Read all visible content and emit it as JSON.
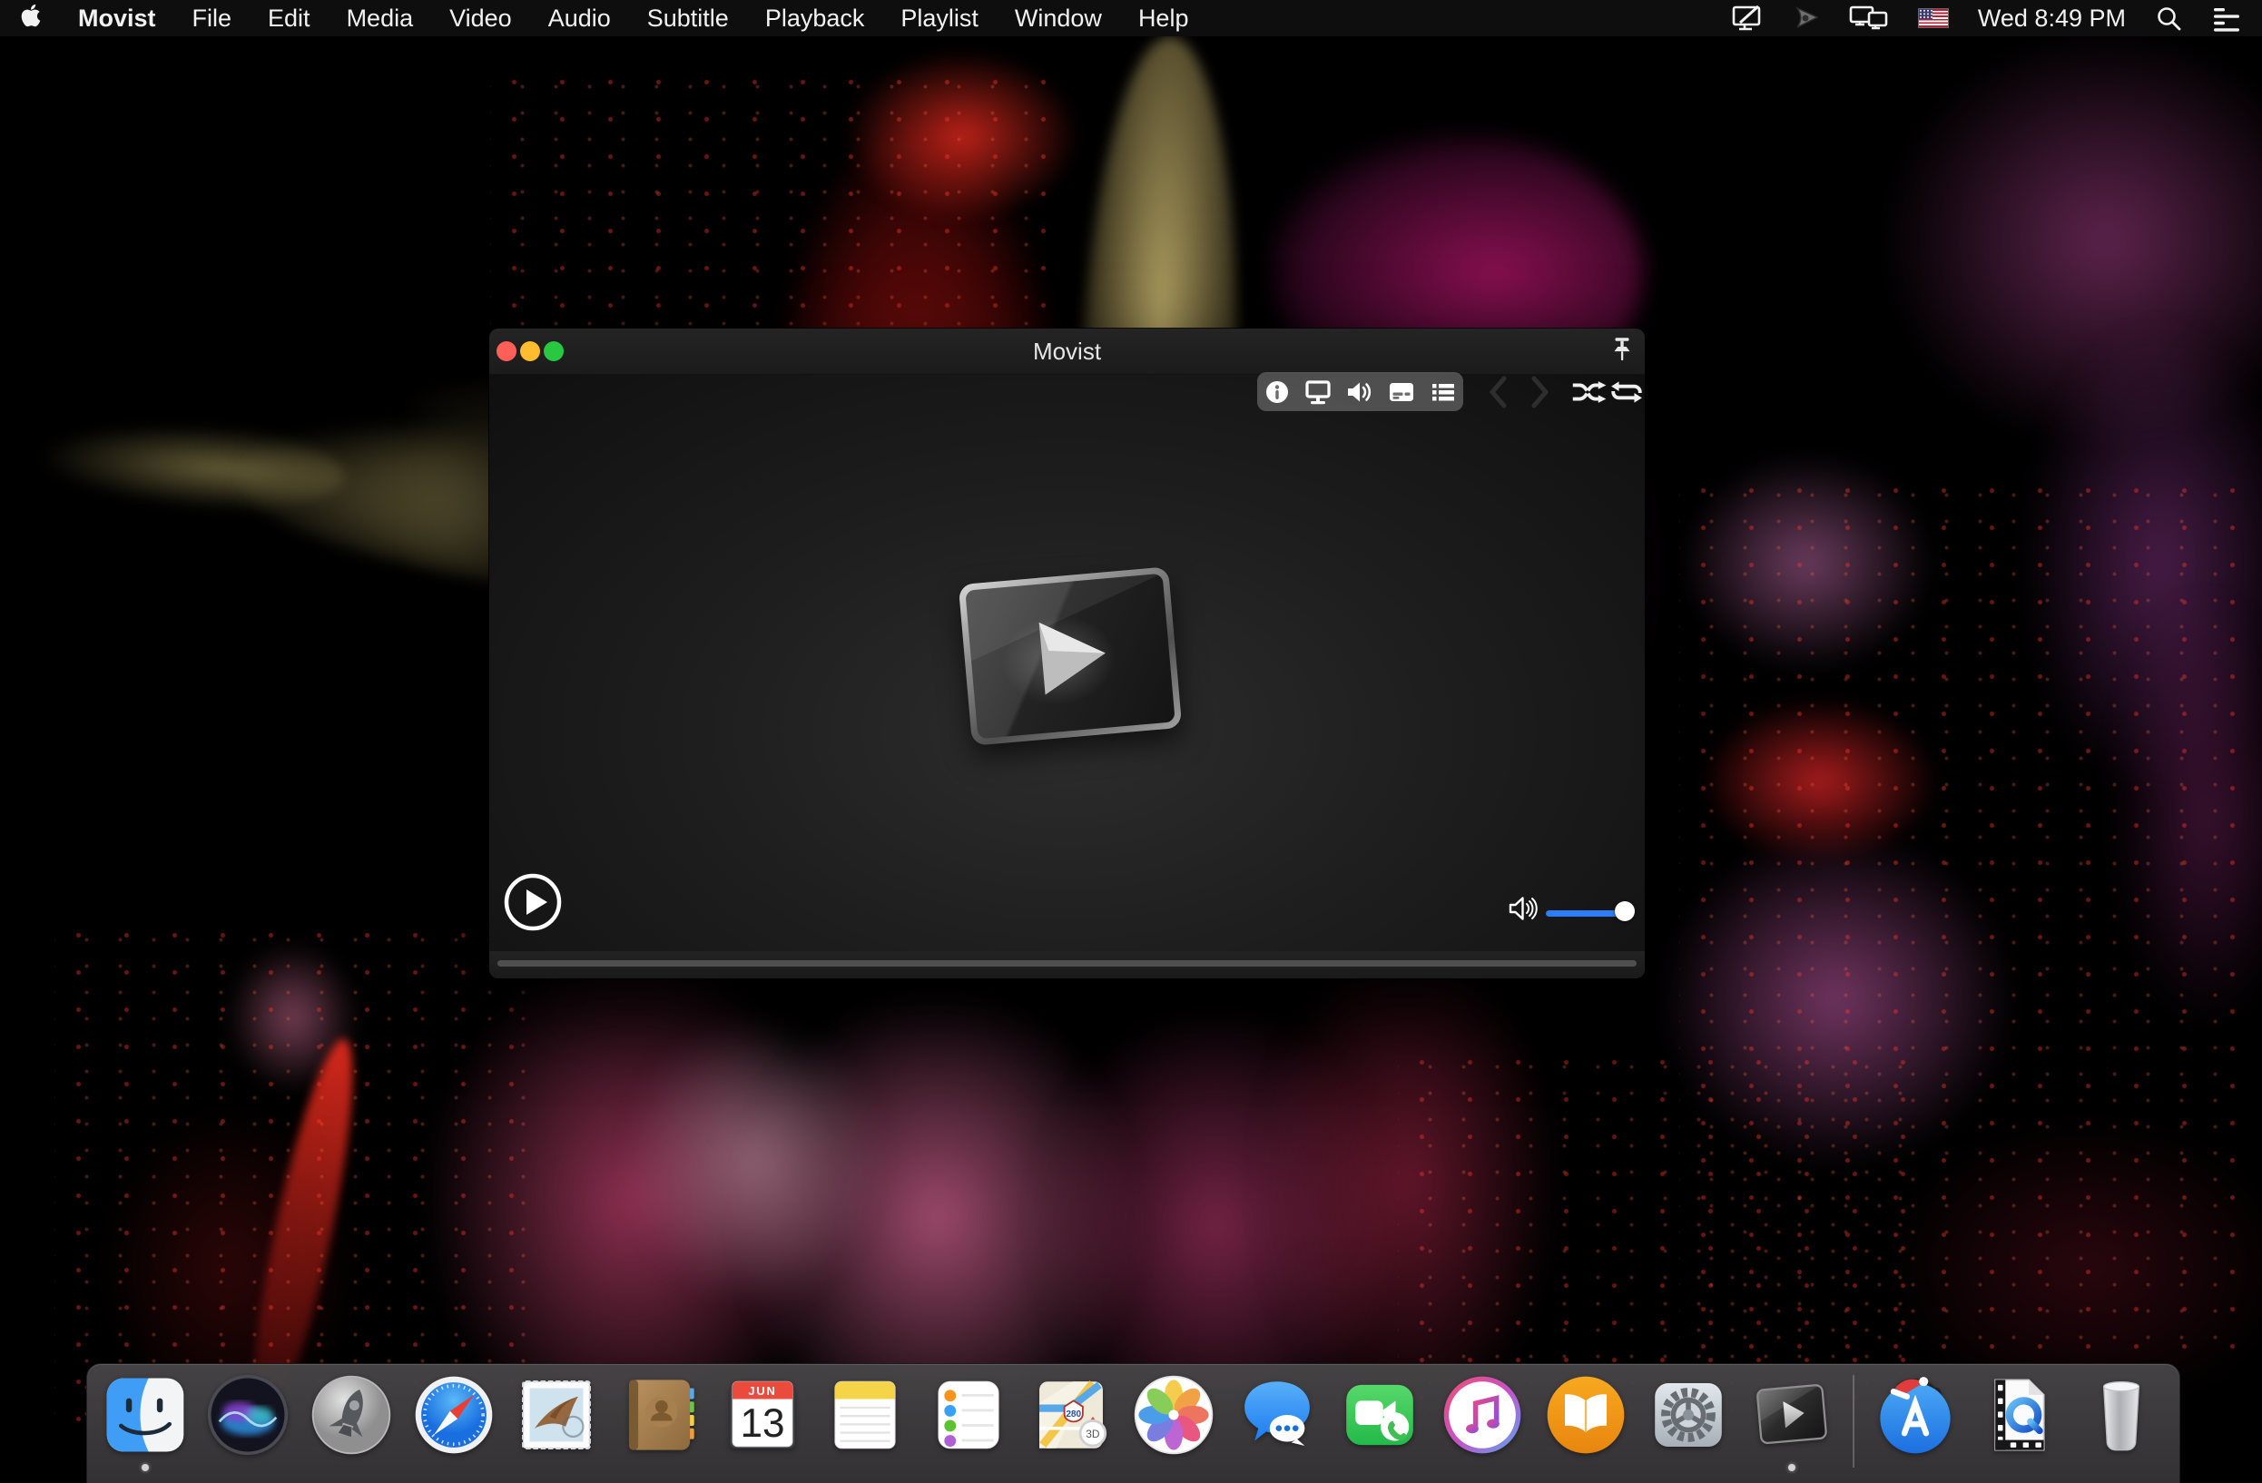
{
  "menu_bar": {
    "apple_logo": "apple-logo",
    "app_name": "Movist",
    "menus": [
      {
        "label": "File",
        "name": "menu-file"
      },
      {
        "label": "Edit",
        "name": "menu-edit"
      },
      {
        "label": "Media",
        "name": "menu-media"
      },
      {
        "label": "Video",
        "name": "menu-video"
      },
      {
        "label": "Audio",
        "name": "menu-audio"
      },
      {
        "label": "Subtitle",
        "name": "menu-subtitle"
      },
      {
        "label": "Playback",
        "name": "menu-playback"
      },
      {
        "label": "Playlist",
        "name": "menu-playlist"
      },
      {
        "label": "Window",
        "name": "menu-window"
      },
      {
        "label": "Help",
        "name": "menu-help"
      }
    ],
    "status_icons": [
      "screen-recording-icon",
      "fan-menu-icon",
      "displays-icon",
      "us-flag-icon"
    ],
    "clock": "Wed 8:49 PM",
    "trailing_icons": [
      "spotlight-search-icon",
      "notification-center-icon"
    ]
  },
  "window": {
    "title": "Movist",
    "traffic_lights": {
      "close": "#ff5f57",
      "minimize": "#febc2e",
      "zoom": "#28c840"
    },
    "pin": "pin-icon",
    "toolbar_icons": [
      "media-info",
      "video-screen",
      "audio-volume",
      "subtitles",
      "playlist"
    ],
    "transport": [
      "previous",
      "next",
      "shuffle",
      "repeat"
    ],
    "play_button": "play",
    "volume": {
      "level_percent": 100,
      "slider_color": "#2e7cf6"
    },
    "seek": {
      "position_percent": 0
    }
  },
  "dock": {
    "items": [
      "finder",
      "siri",
      "launchpad",
      "safari",
      "mail",
      "contacts",
      "calendar",
      "notes",
      "reminders",
      "maps",
      "photos",
      "messages",
      "facetime",
      "itunes",
      "books",
      "system-preferences",
      "movist",
      "separator",
      "app-store",
      "quicktime-document",
      "trash"
    ],
    "running": [
      "finder",
      "movist"
    ],
    "calendar": {
      "month": "JUN",
      "day": "13"
    },
    "maps": {
      "shield": "280",
      "button": "3D"
    }
  },
  "colors": {
    "menu_bar_bg": "#0e0e0e",
    "window_bg": "#1e1e1e",
    "dock_bg": "#464446",
    "volume_blue": "#2e7cf6",
    "seek_gray": "#4f4f4f"
  }
}
